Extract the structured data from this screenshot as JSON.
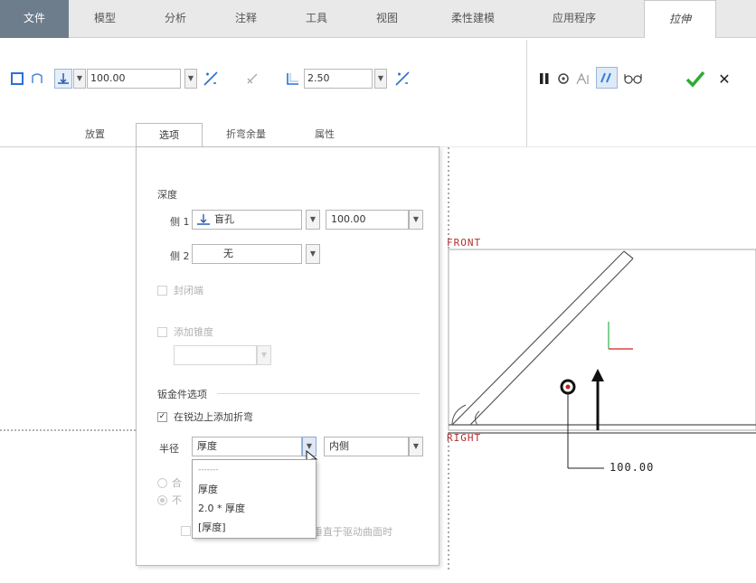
{
  "ribbon": {
    "tabs": [
      {
        "label": "文件"
      },
      {
        "label": "模型"
      },
      {
        "label": "分析"
      },
      {
        "label": "注释"
      },
      {
        "label": "工具"
      },
      {
        "label": "视图"
      },
      {
        "label": "柔性建模"
      },
      {
        "label": "应用程序"
      },
      {
        "label": "拉伸"
      }
    ]
  },
  "toolbar": {
    "depth_value": "100.00",
    "thickness_value": "2.50"
  },
  "subtabs": [
    {
      "label": "放置"
    },
    {
      "label": "选项"
    },
    {
      "label": "折弯余量"
    },
    {
      "label": "属性"
    }
  ],
  "options": {
    "depth_heading": "深度",
    "side1_label": "侧 1",
    "side1_type": "盲孔",
    "side1_value": "100.00",
    "side2_label": "侧 2",
    "side2_type": "无",
    "capped_ends": "封闭端",
    "add_taper": "添加锥度",
    "sheetmetal_heading": "钣金件选项",
    "add_bends_on_edges": "在锐边上添加折弯",
    "radius_label": "半径",
    "radius_value": "厚度",
    "radius_side": "内侧",
    "radio1_fragment": "合",
    "radio2_fragment": "不",
    "trailing_fragment": "垂直于驱动曲面时"
  },
  "radius_dropdown": {
    "items": [
      "-------",
      "厚度",
      "2.0 * 厚度",
      "[厚度]"
    ]
  },
  "graphics": {
    "front_label": "FRONT",
    "right_label": "RIGHT",
    "dimension_text": "100.00",
    "colors": {
      "plane": "#b03030",
      "csys_y": "#2fb54a",
      "csys_x": "#d02020",
      "model": "#555555"
    }
  }
}
